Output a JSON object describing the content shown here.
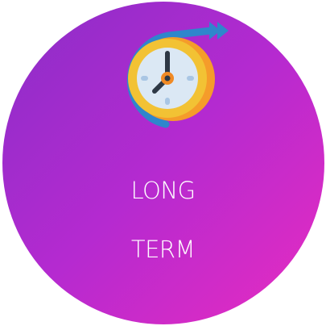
{
  "icon": "clock-with-arrow-icon",
  "colors": {
    "gradient_start": "#8a2ec8",
    "gradient_end": "#e82cc0",
    "text": "#ffffff",
    "arrow": "#2f86cc",
    "clock_rim": "#f2b431",
    "clock_face": "#dbe8f4"
  },
  "title": {
    "line1": "LONG",
    "line2": "TERM"
  }
}
